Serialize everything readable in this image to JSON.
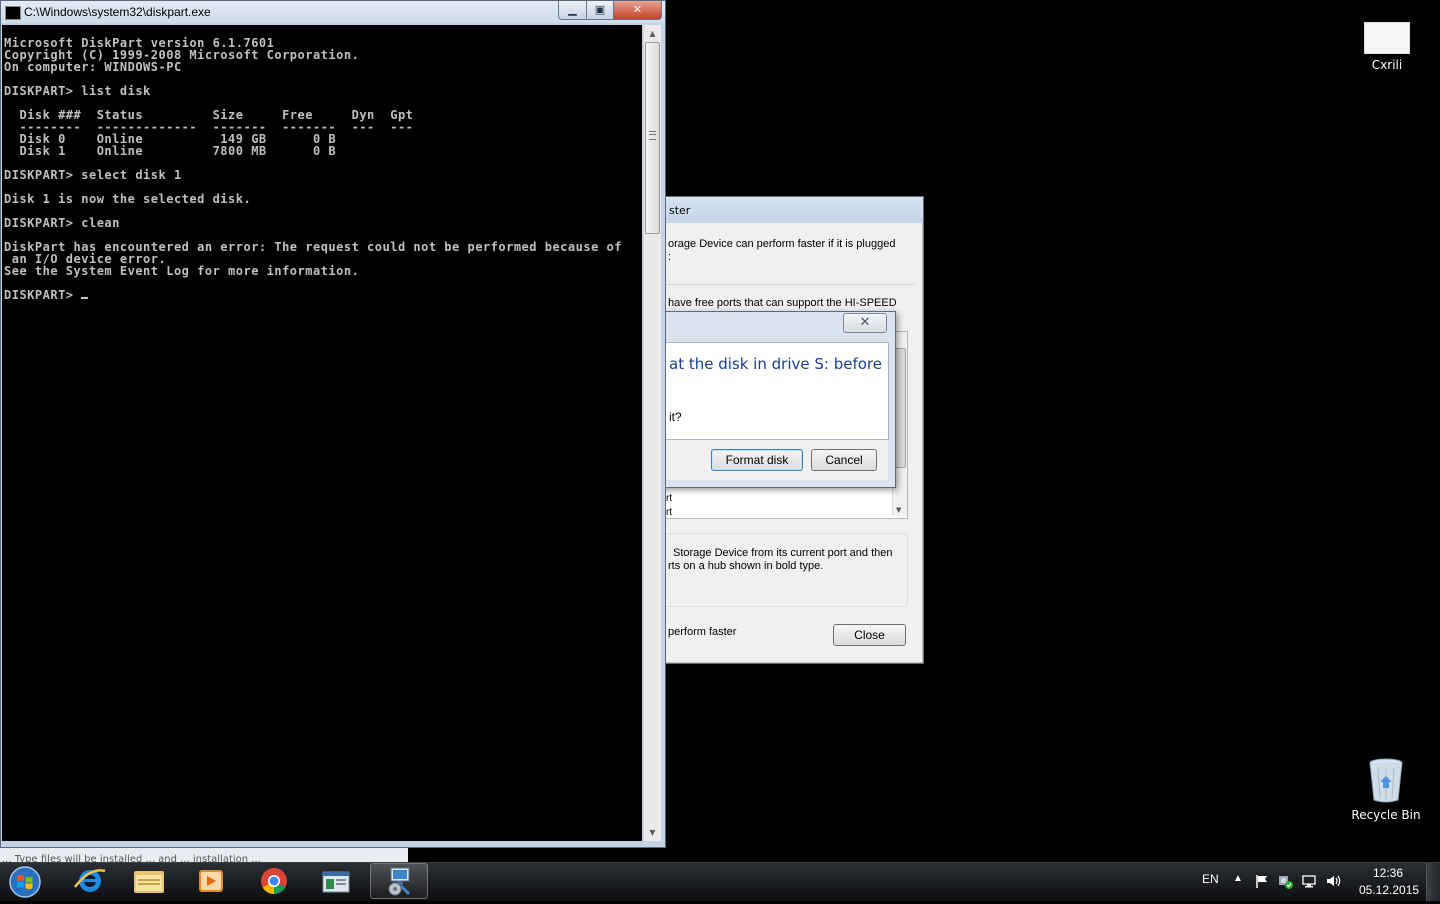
{
  "desktop": {
    "icons": [
      {
        "label": "Cxrili"
      },
      {
        "label": "Recycle Bin"
      }
    ]
  },
  "console": {
    "title": "C:\\Windows\\system32\\diskpart.exe",
    "lines": [
      "Microsoft DiskPart version 6.1.7601",
      "Copyright (C) 1999-2008 Microsoft Corporation.",
      "On computer: WINDOWS-PC",
      "",
      "DISKPART> list disk",
      "",
      "  Disk ###  Status         Size     Free     Dyn  Gpt",
      "  --------  -------------  -------  -------  ---  ---",
      "  Disk 0    Online          149 GB      0 B",
      "  Disk 1    Online         7800 MB      0 B",
      "",
      "DISKPART> select disk 1",
      "",
      "Disk 1 is now the selected disk.",
      "",
      "DISKPART> clean",
      "",
      "DiskPart has encountered an error: The request could not be performed because of",
      " an I/O device error.",
      "See the System Event Log for more information.",
      "",
      "DISKPART> "
    ]
  },
  "usb_dialog": {
    "title_fragment": "ster",
    "text1_line1": "orage Device can perform faster if it is plugged",
    "text1_line2": ":",
    "text2": " have free ports that can support the HI-SPEED",
    "list_items": [
      "rt",
      "rt"
    ],
    "text3_line1": " Storage Device from its current port and then",
    "text3_line2": "rts on a hub shown in bold type.",
    "checkbox_label": "perform faster",
    "close_label": "Close"
  },
  "format_dialog": {
    "heading": "at the disk in drive S: before",
    "question": "it?",
    "format_button": "Format disk",
    "cancel_button": "Cancel",
    "close_symbol": "✕"
  },
  "bottom_strip": {
    "text": "... Type files will be installed ... and ... installation ..."
  },
  "taskbar": {
    "buttons": [
      {
        "name": "internet-explorer"
      },
      {
        "name": "windows-explorer"
      },
      {
        "name": "media-player"
      },
      {
        "name": "chrome"
      },
      {
        "name": "document-app"
      },
      {
        "name": "device-setup"
      }
    ],
    "language": "EN",
    "time": "12:36",
    "date": "05.12.2015"
  }
}
